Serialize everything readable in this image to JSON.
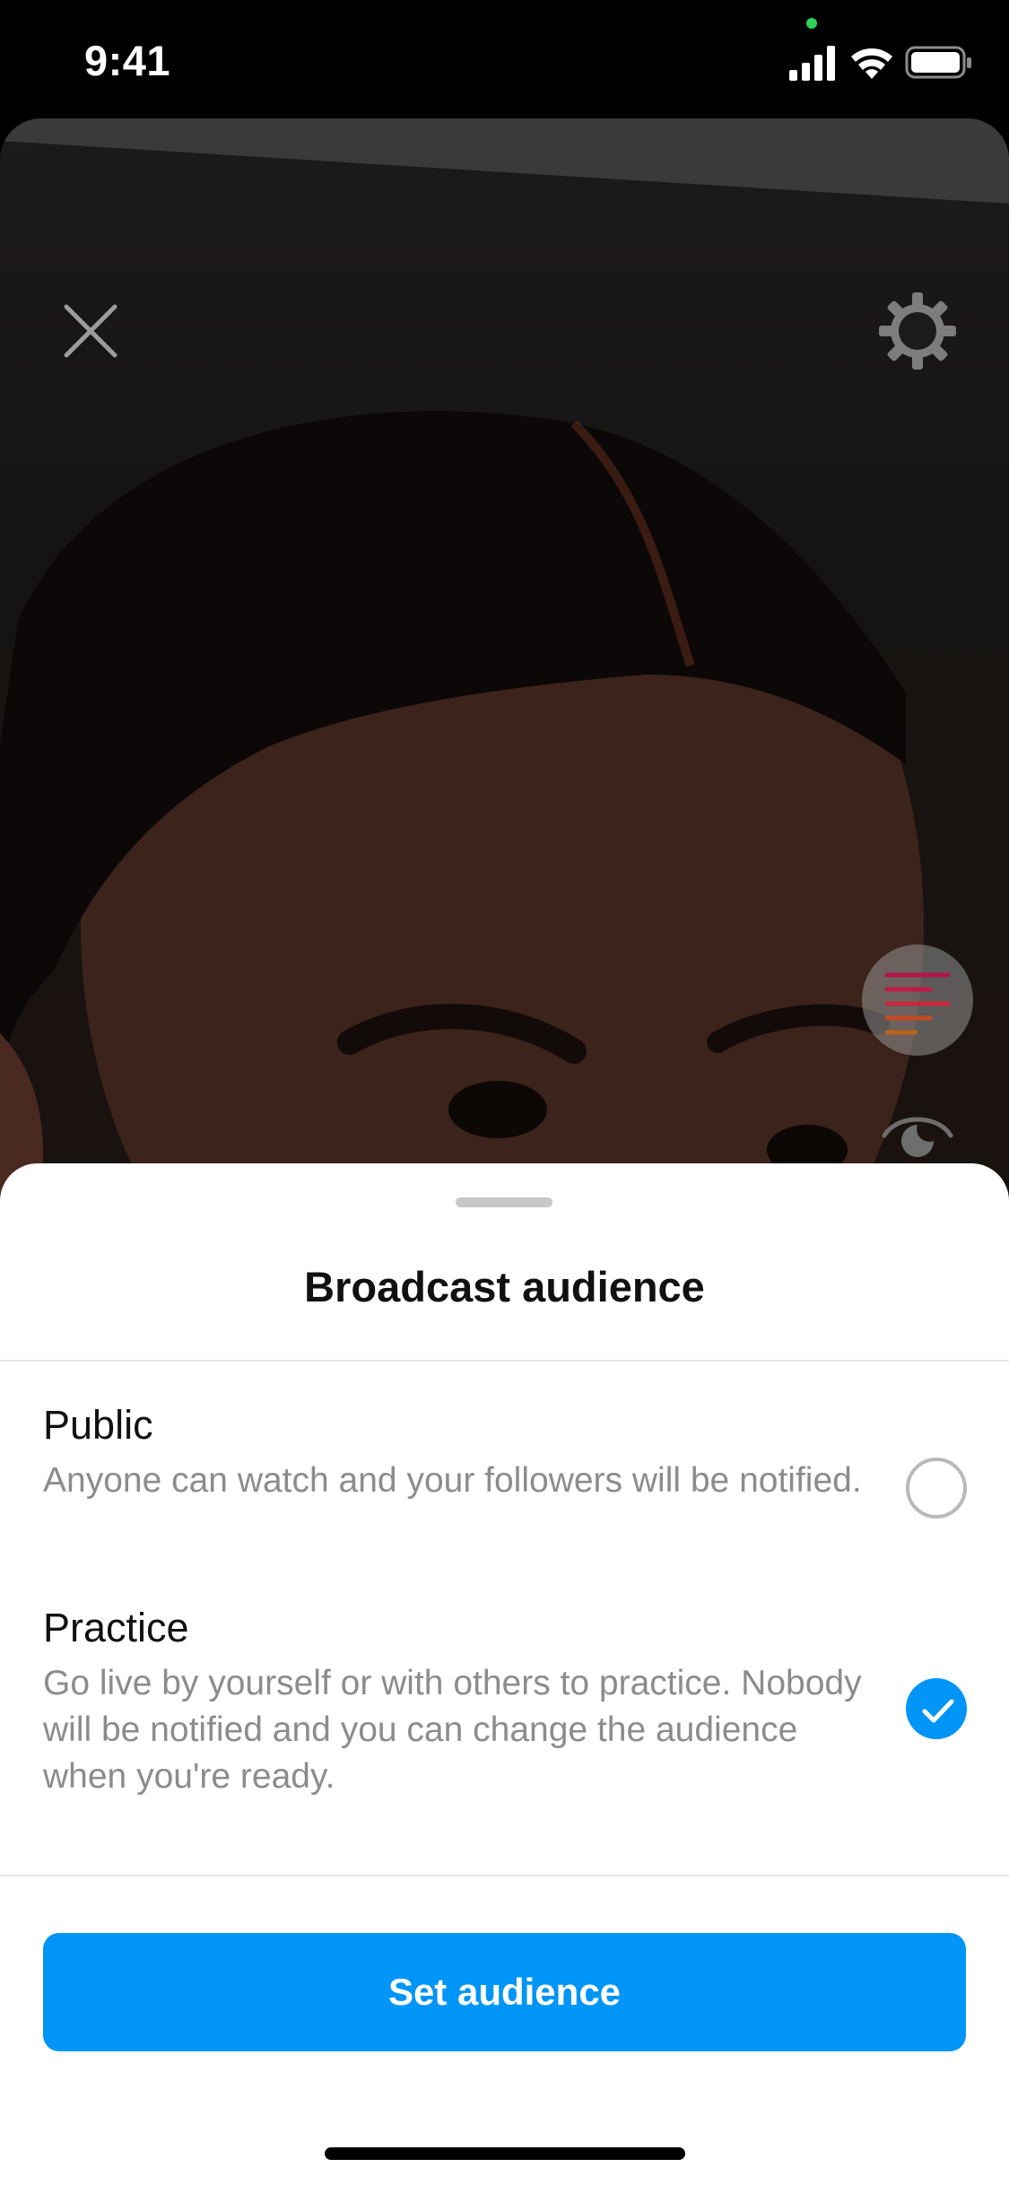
{
  "status_bar": {
    "time": "9:41"
  },
  "camera": {
    "controls": {
      "close_icon": "close-icon",
      "settings_icon": "gear-icon"
    },
    "tools": [
      "text-lines-icon",
      "eye-icon",
      "calendar-icon"
    ]
  },
  "sheet": {
    "title": "Broadcast audience",
    "options": [
      {
        "title": "Public",
        "description": "Anyone can watch and your followers will be notified.",
        "selected": false
      },
      {
        "title": "Practice",
        "description": "Go live by yourself or with others to practice. Nobody will be notified and you can change the audience when you're ready.",
        "selected": true
      }
    ],
    "button_label": "Set audience"
  },
  "colors": {
    "accent": "#0095f6",
    "sheet_bg": "#ffffff",
    "secondary_text": "#8c8c8c"
  }
}
